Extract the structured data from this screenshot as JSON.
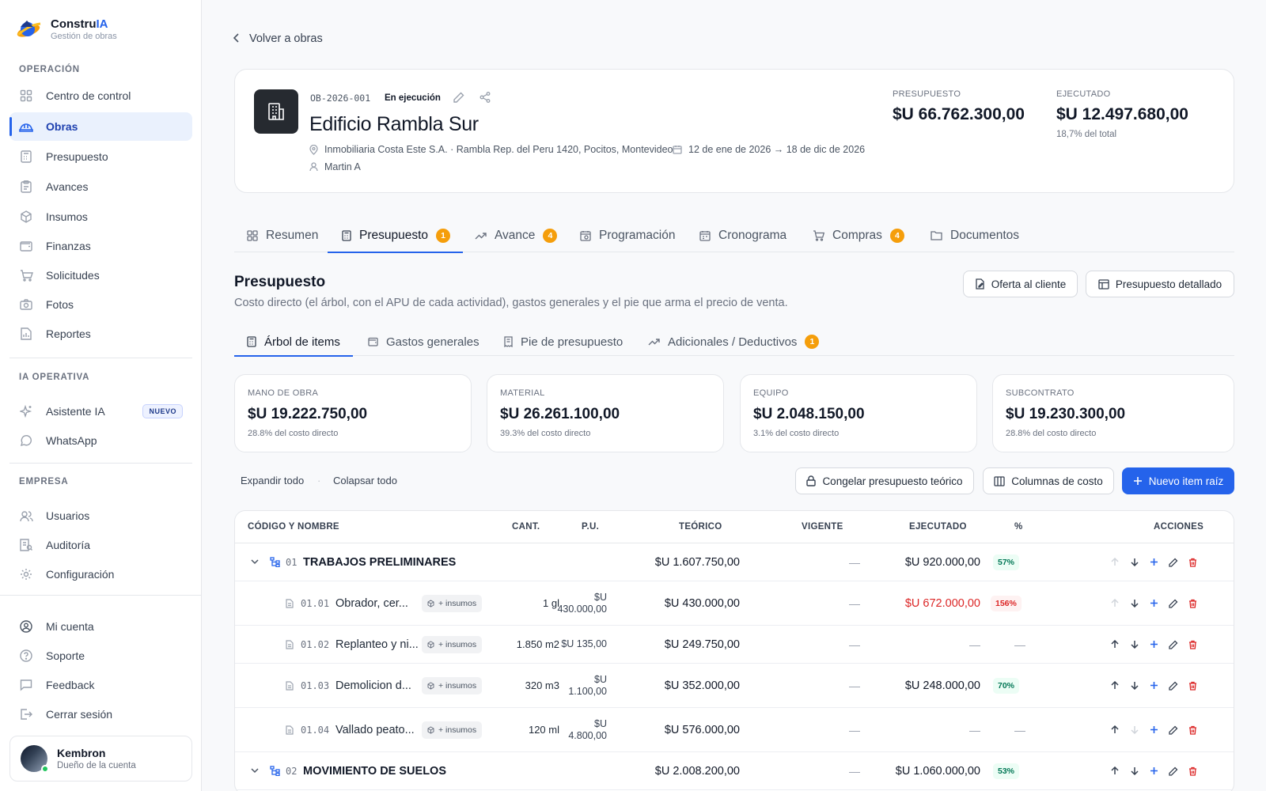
{
  "brand": {
    "name": "Constru",
    "name_accent": "IA",
    "subtitle": "Gestión de obras"
  },
  "sidebar": {
    "sections": [
      {
        "title": "OPERACIÓN"
      },
      {
        "title": "IA OPERATIVA"
      },
      {
        "title": "EMPRESA"
      }
    ],
    "operacion": [
      "Centro de control",
      "Obras",
      "Presupuesto",
      "Avances",
      "Insumos",
      "Finanzas",
      "Solicitudes",
      "Fotos",
      "Reportes"
    ],
    "ia": [
      "Asistente IA",
      "WhatsApp"
    ],
    "ia_badge": "NUEVO",
    "empresa": [
      "Usuarios",
      "Auditoría",
      "Configuración"
    ],
    "cuenta": [
      "Mi cuenta",
      "Soporte",
      "Feedback",
      "Cerrar sesión"
    ],
    "user": {
      "name": "Kembron",
      "role": "Dueño de la cuenta"
    }
  },
  "back_label": "Volver a obras",
  "obra": {
    "code": "OB-2026-001",
    "status": "En ejecución",
    "title": "Edificio Rambla Sur",
    "location": "Inmobiliaria Costa Este S.A. · Rambla Rep. del Peru 1420, Pocitos, Montevideo",
    "dates": "12 de ene de 2026 → 18 de dic de 2026",
    "manager": "Martin A",
    "presupuesto_label": "PRESUPUESTO",
    "presupuesto_value": "$U 66.762.300,00",
    "ejecutado_label": "EJECUTADO",
    "ejecutado_value": "$U 12.497.680,00",
    "ejecutado_sub": "18,7% del total"
  },
  "tabs": [
    {
      "label": "Resumen",
      "count": ""
    },
    {
      "label": "Presupuesto",
      "count": "1"
    },
    {
      "label": "Avance",
      "count": "4"
    },
    {
      "label": "Programación",
      "count": ""
    },
    {
      "label": "Cronograma",
      "count": ""
    },
    {
      "label": "Compras",
      "count": "4"
    },
    {
      "label": "Documentos",
      "count": ""
    }
  ],
  "section": {
    "title": "Presupuesto",
    "description": "Costo directo (el árbol, con el APU de cada actividad), gastos generales y el pie que arma el precio de venta.",
    "btn_oferta": "Oferta al cliente",
    "btn_detallado": "Presupuesto detallado"
  },
  "subtabs": [
    {
      "label": "Árbol de items",
      "count": ""
    },
    {
      "label": "Gastos generales",
      "count": ""
    },
    {
      "label": "Pie de presupuesto",
      "count": ""
    },
    {
      "label": "Adicionales / Deductivos",
      "count": "1"
    }
  ],
  "cost_cards": [
    {
      "label": "MANO DE OBRA",
      "value": "$U 19.222.750,00",
      "sub": "28.8% del costo directo"
    },
    {
      "label": "MATERIAL",
      "value": "$U 26.261.100,00",
      "sub": "39.3% del costo directo"
    },
    {
      "label": "EQUIPO",
      "value": "$U 2.048.150,00",
      "sub": "3.1% del costo directo"
    },
    {
      "label": "SUBCONTRATO",
      "value": "$U 19.230.300,00",
      "sub": "28.8% del costo directo"
    }
  ],
  "toolbar": {
    "expand": "Expandir todo",
    "collapse": "Colapsar todo",
    "freeze": "Congelar presupuesto teórico",
    "columns": "Columnas de costo",
    "new_item": "Nuevo item raíz"
  },
  "table": {
    "headers": {
      "name": "CÓDIGO Y NOMBRE",
      "cant": "CANT.",
      "pu": "P.U.",
      "teorico": "TEÓRICO",
      "vigente": "VIGENTE",
      "ejecutado": "EJECUTADO",
      "pct": "%",
      "acciones": "ACCIONES"
    },
    "insumos_label": "+ insumos",
    "rows": [
      {
        "code": "01",
        "name": "TRABAJOS PRELIMINARES",
        "cant": "",
        "pu1": "",
        "pu2": "",
        "teorico": "$U 1.607.750,00",
        "vigente": "—",
        "ejecutado": "$U 920.000,00",
        "pct": "57%"
      },
      {
        "code": "01.01",
        "name": "Obrador, cer...",
        "cant": "1 gl",
        "pu1": "$U",
        "pu2": "430.000,00",
        "teorico": "$U 430.000,00",
        "vigente": "—",
        "ejecutado": "$U 672.000,00",
        "pct": "156%"
      },
      {
        "code": "01.02",
        "name": "Replanteo y ni...",
        "cant": "1.850 m2",
        "pu1": "$U 135,00",
        "pu2": "",
        "teorico": "$U 249.750,00",
        "vigente": "—",
        "ejecutado": "—",
        "pct": "—"
      },
      {
        "code": "01.03",
        "name": "Demolicion d...",
        "cant": "320 m3",
        "pu1": "$U",
        "pu2": "1.100,00",
        "teorico": "$U 352.000,00",
        "vigente": "—",
        "ejecutado": "$U 248.000,00",
        "pct": "70%"
      },
      {
        "code": "01.04",
        "name": "Vallado peato...",
        "cant": "120 ml",
        "pu1": "$U",
        "pu2": "4.800,00",
        "teorico": "$U 576.000,00",
        "vigente": "—",
        "ejecutado": "—",
        "pct": "—"
      },
      {
        "code": "02",
        "name": "MOVIMIENTO DE SUELOS",
        "cant": "",
        "pu1": "",
        "pu2": "",
        "teorico": "$U 2.008.200,00",
        "vigente": "—",
        "ejecutado": "$U 1.060.000,00",
        "pct": "53%"
      }
    ]
  }
}
